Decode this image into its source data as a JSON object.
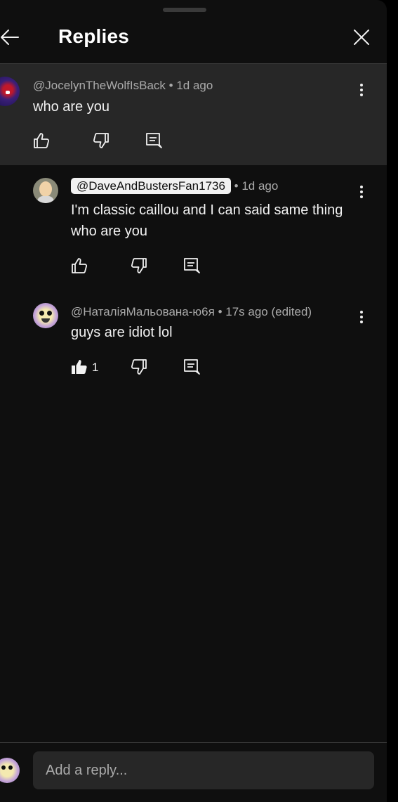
{
  "header": {
    "title": "Replies"
  },
  "parent_comment": {
    "author": "@JocelynTheWolfIsBack",
    "time": "• 1d ago",
    "text": "who are you"
  },
  "replies": [
    {
      "author": "@DaveAndBustersFan1736",
      "time": "• 1d ago",
      "line1": "I'm classic caillou and I can said same thing",
      "line2": "who are you"
    },
    {
      "author": "@НаталіяМальована-ю6я",
      "time": "• 17s ago (edited)",
      "text": "guys are  idiot lol",
      "like_count": "1"
    }
  ],
  "footer": {
    "reply_placeholder": "Add a reply..."
  },
  "colors": {
    "sheet_bg": "#0f0f0f",
    "highlight_bg": "#272727",
    "text": "#f1f1f1",
    "muted": "#aaaaaa"
  }
}
